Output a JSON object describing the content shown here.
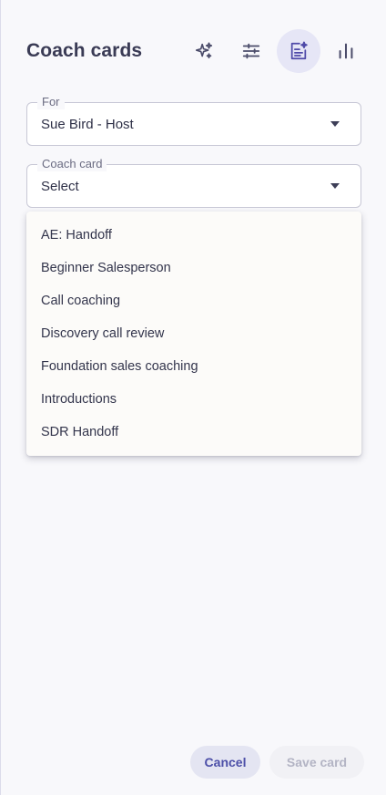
{
  "header": {
    "title": "Coach cards",
    "icons": [
      "sparkle-icon",
      "filter-lines-icon",
      "coach-card-icon",
      "bar-chart-icon"
    ],
    "active_icon": "coach-card-icon"
  },
  "form": {
    "for_label": "For",
    "for_value": "Sue Bird - Host",
    "card_label": "Coach card",
    "card_value": "Select"
  },
  "menu": {
    "items": [
      "AE: Handoff",
      "Beginner Salesperson",
      "Call coaching",
      "Discovery call review",
      "Foundation sales coaching",
      "Introductions",
      "SDR Handoff"
    ]
  },
  "footer": {
    "cancel_label": "Cancel",
    "save_label": "Save card"
  },
  "colors": {
    "accent": "#4f4aa8",
    "active_icon_bg": "#e6e6f6",
    "cancel_bg": "#e4e5f2",
    "save_disabled_text": "#b3b4c4"
  }
}
